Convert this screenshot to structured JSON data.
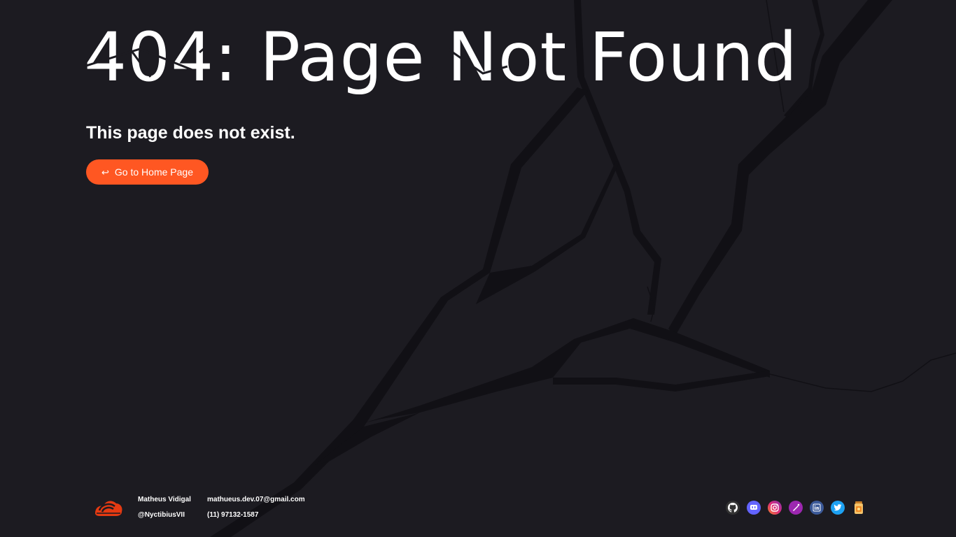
{
  "error": {
    "headline": "404: Page Not Found",
    "message": "This page does not exist.",
    "home_button_label": "Go to Home Page",
    "home_button_icon": "return-arrow-icon"
  },
  "footer": {
    "name": "Matheus Vidigal",
    "handle": "@NyctibiusVII",
    "email": "mathueus.dev.07@gmail.com",
    "phone": "(11) 97132-1587",
    "socials": [
      {
        "icon": "github-icon",
        "color": "#333333"
      },
      {
        "icon": "mastodon-icon",
        "color": "#6364ff"
      },
      {
        "icon": "instagram-icon",
        "color": "#833ab4"
      },
      {
        "icon": "dribbble-like-pen-icon",
        "color": "#8e24aa"
      },
      {
        "icon": "linkedin-icon",
        "color": "#0a66c2"
      },
      {
        "icon": "twitter-icon",
        "color": "#1da1f2"
      },
      {
        "icon": "jar-icon",
        "color": "#f5a623"
      }
    ]
  },
  "colors": {
    "background": "#1c1b21",
    "crack": "#111015",
    "accent": "#ff5722",
    "text": "#ffffff"
  }
}
